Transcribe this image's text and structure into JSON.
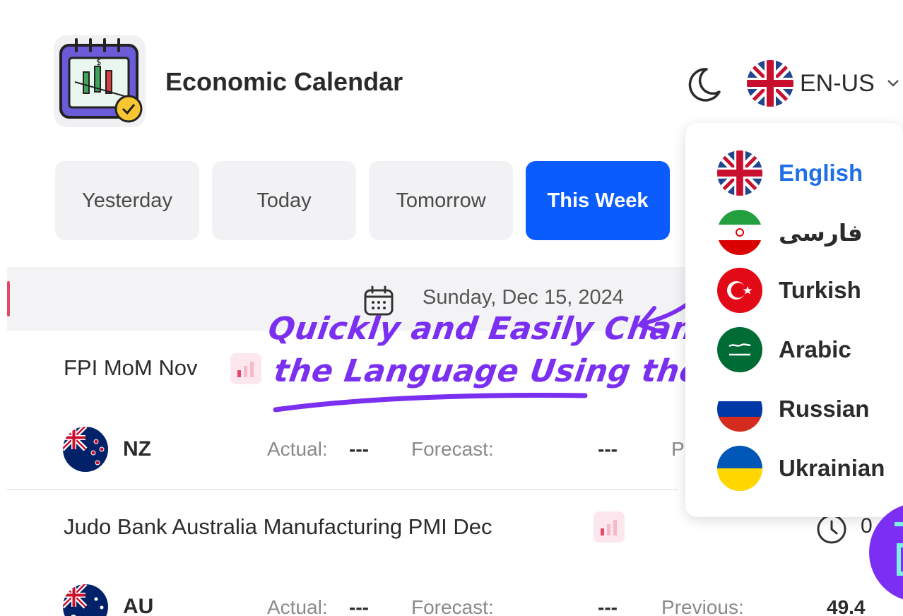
{
  "header": {
    "title": "Economic Calendar",
    "language_code": "EN-US"
  },
  "tabs": [
    {
      "label": "Yesterday",
      "active": false
    },
    {
      "label": "Today",
      "active": false
    },
    {
      "label": "Tomorrow",
      "active": false
    },
    {
      "label": "This Week",
      "active": true
    }
  ],
  "date": "Sunday, Dec 15, 2024",
  "events": [
    {
      "title": "FPI MoM Nov",
      "country": "NZ",
      "actual_label": "Actual:",
      "actual_value": "---",
      "forecast_label": "Forecast:",
      "forecast_value": "---",
      "previous_label_fragment": "P"
    },
    {
      "title": "Judo Bank Australia Manufacturing PMI Dec",
      "country": "AU",
      "actual_label": "Actual:",
      "actual_value": "---",
      "forecast_label": "Forecast:",
      "forecast_value": "---",
      "previous_label": "Previous:",
      "previous_value": "49.4",
      "time_fragment": "0"
    }
  ],
  "language_menu": [
    {
      "label": "English",
      "flag_icon": "uk-flag-icon",
      "selected": true
    },
    {
      "label": "فارسی",
      "flag_icon": "iran-flag-icon",
      "selected": false
    },
    {
      "label": "Turkish",
      "flag_icon": "turkey-flag-icon",
      "selected": false
    },
    {
      "label": "Arabic",
      "flag_icon": "saudi-flag-icon",
      "selected": false
    },
    {
      "label": "Russian",
      "flag_icon": "russia-flag-icon",
      "selected": false
    },
    {
      "label": "Ukrainian",
      "flag_icon": "ukraine-flag-icon",
      "selected": false
    }
  ],
  "annotation": {
    "line1": "Quickly and Easily Change",
    "line2": "the Language Using the Menu"
  },
  "colors": {
    "accent": "#0a5cff",
    "selected_language": "#1f6fe6",
    "annotation": "#7b2ff0",
    "impact_low": "#e34868"
  }
}
